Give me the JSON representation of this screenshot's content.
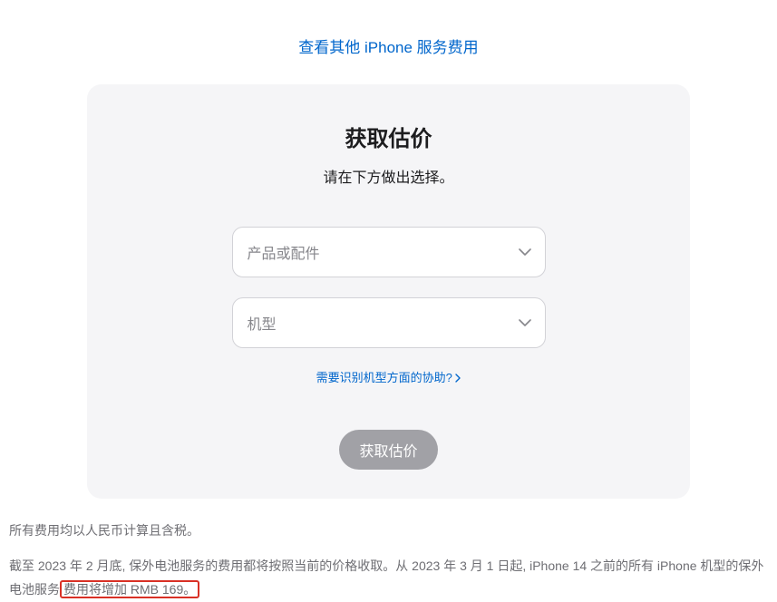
{
  "topLink": "查看其他 iPhone 服务费用",
  "card": {
    "title": "获取估价",
    "subtitle": "请在下方做出选择。",
    "select1Placeholder": "产品或配件",
    "select2Placeholder": "机型",
    "helpLink": "需要识别机型方面的协助?",
    "submitLabel": "获取估价"
  },
  "footer": {
    "line1": "所有费用均以人民币计算且含税。",
    "line2_prefix": "截至 2023 年 2 月底, 保外电池服务的费用都将按照当前的价格收取。从 2023 年 3 月 1 日起, iPhone 14 之前的所有 iPhone 机型的保外电池服务",
    "line2_highlight": "费用将增加 RMB 169。"
  }
}
